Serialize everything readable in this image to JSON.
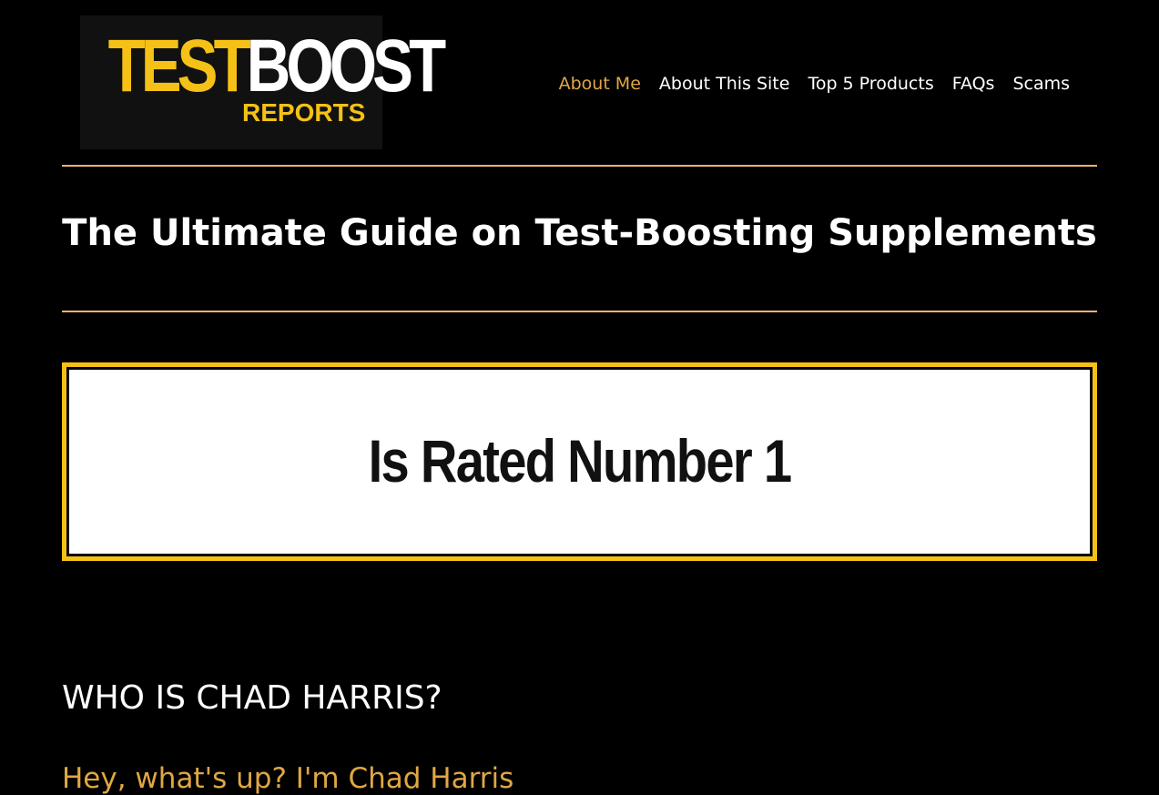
{
  "logo": {
    "word_test": "TEST",
    "word_boost": "BOOST",
    "word_reports": "REPORTS"
  },
  "nav": {
    "items": [
      {
        "label": "About Me",
        "active": true
      },
      {
        "label": "About This Site",
        "active": false
      },
      {
        "label": "Top 5 Products",
        "active": false
      },
      {
        "label": "FAQs",
        "active": false
      },
      {
        "label": "Scams",
        "active": false
      }
    ]
  },
  "site": {
    "title": "The Ultimate Guide on Test-Boosting Supplements"
  },
  "banner": {
    "text": "Is Rated Number 1"
  },
  "content": {
    "heading": "WHO IS CHAD HARRIS?",
    "subheading": "Hey, what's up? I'm Chad Harris"
  },
  "colors": {
    "accent_gold": "#f5c116",
    "nav_active": "#e0a744",
    "rule": "#e9b56a",
    "background": "#000000"
  }
}
